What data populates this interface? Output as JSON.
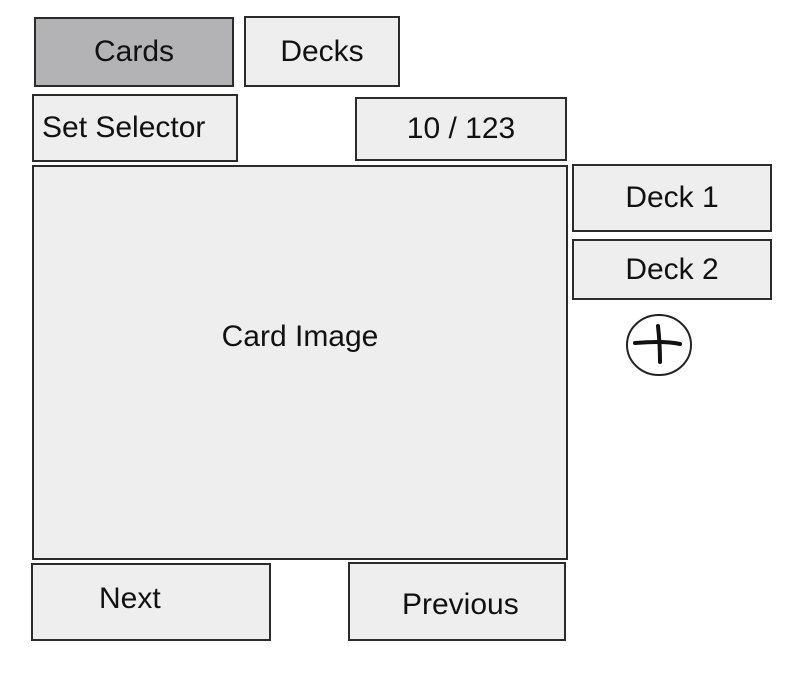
{
  "tabs": {
    "cards_label": "Cards",
    "decks_label": "Decks",
    "active": "Cards"
  },
  "controls": {
    "set_selector_label": "Set Selector",
    "page_counter": "10 / 123"
  },
  "card": {
    "image_placeholder": "Card Image"
  },
  "decks": {
    "items": [
      {
        "label": "Deck 1"
      },
      {
        "label": "Deck 2"
      }
    ],
    "add_icon": "plus-circle-icon"
  },
  "navigation": {
    "next_label": "Next",
    "previous_label": "Previous"
  },
  "colors": {
    "panel_background": "#eeeeee",
    "active_tab_background": "#b3b3b5",
    "border": "#2b2b2b"
  }
}
